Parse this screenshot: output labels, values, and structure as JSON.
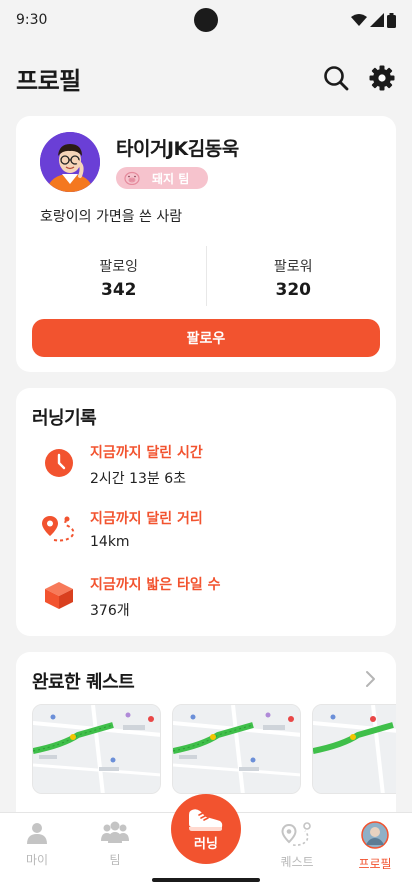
{
  "status_bar": {
    "time": "9:30"
  },
  "header": {
    "title": "프로필"
  },
  "profile": {
    "username": "타이거JK김동욱",
    "team_badge": "돼지 팀",
    "bio": "호랑이의 가면을 쓴 사람",
    "following_label": "팔로잉",
    "following_count": "342",
    "followers_label": "팔로워",
    "followers_count": "320",
    "follow_button": "팔로우"
  },
  "records": {
    "title": "러닝기록",
    "items": [
      {
        "title": "지금까지 달린 시간",
        "value": "2시간 13분 6초",
        "icon": "clock-icon"
      },
      {
        "title": "지금까지 달린 거리",
        "value": "14km",
        "icon": "route-icon"
      },
      {
        "title": "지금까지 밟은 타일 수",
        "value": "376개",
        "icon": "tile-cube-icon"
      }
    ]
  },
  "quests": {
    "title": "완료한 퀘스트"
  },
  "bottom_nav": {
    "items": [
      {
        "label": "마이",
        "icon": "person-icon"
      },
      {
        "label": "팀",
        "icon": "group-icon"
      },
      {
        "label": "러닝",
        "icon": "sneaker-icon"
      },
      {
        "label": "퀘스트",
        "icon": "map-pin-route-icon"
      },
      {
        "label": "프로필",
        "icon": "avatar-icon"
      }
    ],
    "active": "프로필"
  },
  "colors": {
    "accent": "#f2532f",
    "badge_bg": "#f6c3cd",
    "background": "#f3f3f3"
  }
}
